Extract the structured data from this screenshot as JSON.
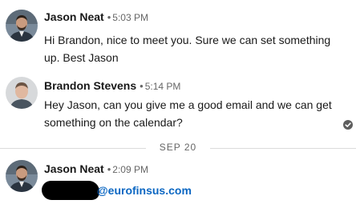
{
  "messages": [
    {
      "sender": "Jason Neat",
      "separator": "•",
      "time": "5:03 PM",
      "text": "Hi Brandon, nice to meet you. Sure we can set something up. Best Jason"
    },
    {
      "sender": "Brandon Stevens",
      "separator": "•",
      "time": "5:14 PM",
      "text": "Hey Jason, can you give me a good email and we can get something on the calendar?"
    },
    {
      "sender": "Jason Neat",
      "separator": "•",
      "time": "2:09 PM",
      "email_visible_part": "@eurofinsus.com"
    }
  ],
  "date_divider": "SEP 20",
  "icons": {
    "read_receipt": "check-circle-icon"
  },
  "colors": {
    "link": "#0a66c2",
    "text": "#191919",
    "muted": "#666666"
  }
}
